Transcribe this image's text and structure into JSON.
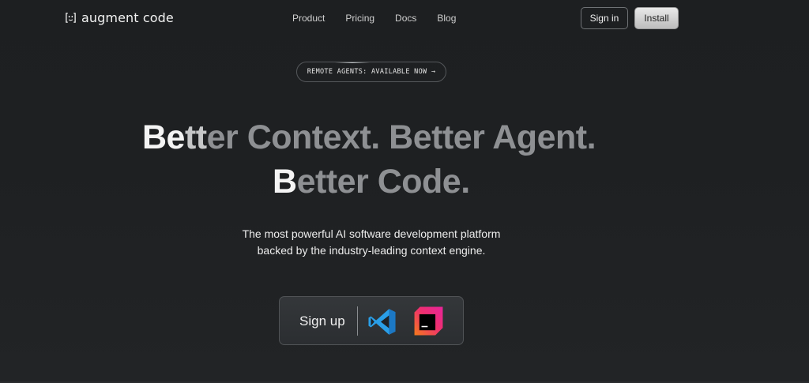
{
  "brand": {
    "name": "augment code",
    "logo_icon": "bracket-face-icon"
  },
  "nav": {
    "links": [
      "Product",
      "Pricing",
      "Docs",
      "Blog"
    ],
    "sign_in_label": "Sign in",
    "install_label": "Install"
  },
  "badge": {
    "label": "REMOTE AGENTS: AVAILABLE NOW →"
  },
  "hero": {
    "line1": {
      "a": "Be",
      "b": "tt",
      "c": "er Context. Better Agent."
    },
    "line2": {
      "a": "B",
      "b": "etter Code."
    },
    "subtitle_line1": "The most powerful AI software development platform",
    "subtitle_line2": "backed by the industry-leading context engine."
  },
  "signup": {
    "label": "Sign up",
    "icons": [
      "vscode-icon",
      "jetbrains-icon"
    ]
  },
  "colors": {
    "background": "#1e2022",
    "headline_dim": "#8e9093",
    "headline_bright": "#f4f4f4",
    "install_bg": "#d4d4d4",
    "vscode_blue": "#2a9fe8",
    "jetbrains_magenta": "#e8249b",
    "jetbrains_orange": "#f57a1c"
  }
}
